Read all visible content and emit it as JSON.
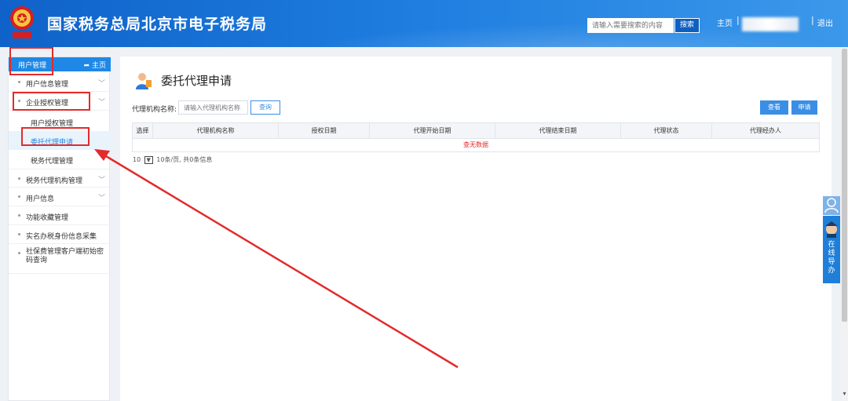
{
  "header": {
    "site_title": "国家税务总局北京市电子税务局",
    "search_placeholder": "请输入需要搜索的内容",
    "search_button": "搜索",
    "home_link": "主页",
    "logout_link": "退出",
    "separator": "|",
    "emblem_icon": "tax-emblem-icon"
  },
  "sidebar": {
    "header_label": "用户管理",
    "home_label": "主页",
    "items": [
      {
        "label": "用户信息管理",
        "expandable": true
      },
      {
        "label": "企业授权管理",
        "expandable": true
      },
      {
        "label": "用户授权管理",
        "sub": true
      },
      {
        "label": "委托代理申请",
        "sub": true,
        "active": true
      },
      {
        "label": "税务代理管理",
        "sub": true
      },
      {
        "label": "税务代理机构管理",
        "expandable": true
      },
      {
        "label": "用户信息",
        "expandable": true
      },
      {
        "label": "功能收藏管理",
        "expandable": false
      },
      {
        "label": "实名办税身份信息采集",
        "expandable": false
      },
      {
        "label": "社保费管理客户端初始密码查询",
        "expandable": false
      }
    ]
  },
  "main": {
    "page_title": "委托代理申请",
    "filter_label": "代理机构名称:",
    "filter_placeholder": "请输入代理机构名称",
    "query_button": "查询",
    "view_button": "查看",
    "apply_button": "申请",
    "table": {
      "columns": [
        "选择",
        "代理机构名称",
        "授权日期",
        "代理开始日期",
        "代理结束日期",
        "代理状态",
        "代理经办人"
      ],
      "empty_text": "查无数据"
    },
    "pager": {
      "page_size": "10",
      "summary": "10条/页, 共0条信息"
    }
  },
  "float_widget": {
    "label": "在线导办"
  },
  "colors": {
    "header_blue": "#1470d6",
    "accent_blue": "#1f88e6",
    "annotation_red": "#e22b2b"
  }
}
